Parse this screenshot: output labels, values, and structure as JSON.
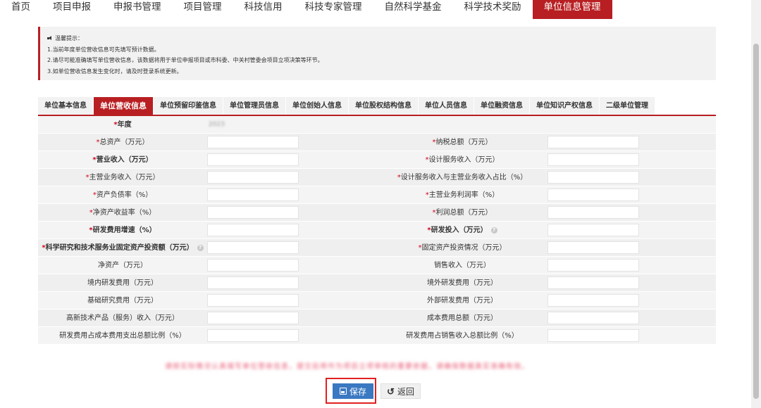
{
  "nav": {
    "items": [
      {
        "label": "首页",
        "active": false
      },
      {
        "label": "项目申报",
        "active": false
      },
      {
        "label": "申报书管理",
        "active": false
      },
      {
        "label": "项目管理",
        "active": false
      },
      {
        "label": "科技信用",
        "active": false
      },
      {
        "label": "科技专家管理",
        "active": false
      },
      {
        "label": "自然科学基金",
        "active": false
      },
      {
        "label": "科学技术奖励",
        "active": false
      },
      {
        "label": "单位信息管理",
        "active": true
      }
    ]
  },
  "notice": {
    "title": "温馨提示：",
    "lines": [
      "1.当前年度单位营收信息可先填写预计数据。",
      "2.请尽可能准确填写单位营收信息，该数据将用于单位申报项目或市科委、中关村管委会项目立项决策等环节。",
      "3.如单位营收信息发生变化时，请及时登录系统更新。"
    ]
  },
  "tabs": [
    {
      "label": "单位基本信息",
      "active": false
    },
    {
      "label": "单位营收信息",
      "active": true
    },
    {
      "label": "单位预留印鉴信息",
      "active": false
    },
    {
      "label": "单位管理员信息",
      "active": false
    },
    {
      "label": "单位创始人信息",
      "active": false
    },
    {
      "label": "单位股权结构信息",
      "active": false
    },
    {
      "label": "单位人员信息",
      "active": false
    },
    {
      "label": "单位融资信息",
      "active": false
    },
    {
      "label": "单位知识产权信息",
      "active": false
    },
    {
      "label": "二级单位管理",
      "active": false
    }
  ],
  "form": {
    "year": {
      "label": "年度",
      "required": true,
      "value": "2023"
    },
    "rows": [
      {
        "left": {
          "label": "总资产（万元）",
          "required": true,
          "bold": false
        },
        "right": {
          "label": "纳税总额（万元）",
          "required": true,
          "bold": false
        }
      },
      {
        "left": {
          "label": "营业收入（万元）",
          "required": true,
          "bold": true
        },
        "right": {
          "label": "设计服务收入（万元）",
          "required": true,
          "bold": false
        }
      },
      {
        "left": {
          "label": "主营业务收入（万元）",
          "required": true,
          "bold": false
        },
        "right": {
          "label": "设计服务收入与主营业务收入占比（%）",
          "required": true,
          "bold": false
        }
      },
      {
        "left": {
          "label": "资产负债率（%）",
          "required": true,
          "bold": false
        },
        "right": {
          "label": "主营业务利润率（%）",
          "required": true,
          "bold": false
        }
      },
      {
        "left": {
          "label": "净资产收益率（%）",
          "required": true,
          "bold": false
        },
        "right": {
          "label": "利润总额（万元）",
          "required": true,
          "bold": false
        }
      },
      {
        "left": {
          "label": "研发费用增速（%）",
          "required": true,
          "bold": true
        },
        "right": {
          "label": "研发投入（万元）",
          "required": true,
          "bold": true,
          "help": true
        }
      },
      {
        "left": {
          "label": "科学研究和技术服务业固定资产投资额（万元）",
          "required": true,
          "bold": true,
          "help": true
        },
        "right": {
          "label": "固定资产投资情况（万元）",
          "required": true,
          "bold": false
        }
      },
      {
        "left": {
          "label": "净资产（万元）",
          "required": false,
          "bold": false
        },
        "right": {
          "label": "销售收入（万元）",
          "required": false,
          "bold": false
        }
      },
      {
        "left": {
          "label": "境内研发费用（万元）",
          "required": false,
          "bold": false
        },
        "right": {
          "label": "境外研发费用（万元）",
          "required": false,
          "bold": false
        }
      },
      {
        "left": {
          "label": "基础研究费用（万元）",
          "required": false,
          "bold": false
        },
        "right": {
          "label": "外部研发费用（万元）",
          "required": false,
          "bold": false
        }
      },
      {
        "left": {
          "label": "高新技术产品（服务）收入（万元）",
          "required": false,
          "bold": false
        },
        "right": {
          "label": "成本费用总额（万元）",
          "required": false,
          "bold": false
        }
      },
      {
        "left": {
          "label": "研发费用占成本费用支出总额比例（%）",
          "required": false,
          "bold": false
        },
        "right": {
          "label": "研发费用占销售收入总额比例（%）",
          "required": false,
          "bold": false
        }
      }
    ]
  },
  "red_note": "请按实际情况认真填写单位营收信息，提交后将作为项目立项审核的重要依据，请确保数据真实准确有效。",
  "buttons": {
    "save": "保存",
    "back": "返回"
  },
  "colors": {
    "brand": "#b81f22",
    "primary_button": "#3a78c2",
    "required": "#d0021b",
    "highlight": "#e02020"
  }
}
